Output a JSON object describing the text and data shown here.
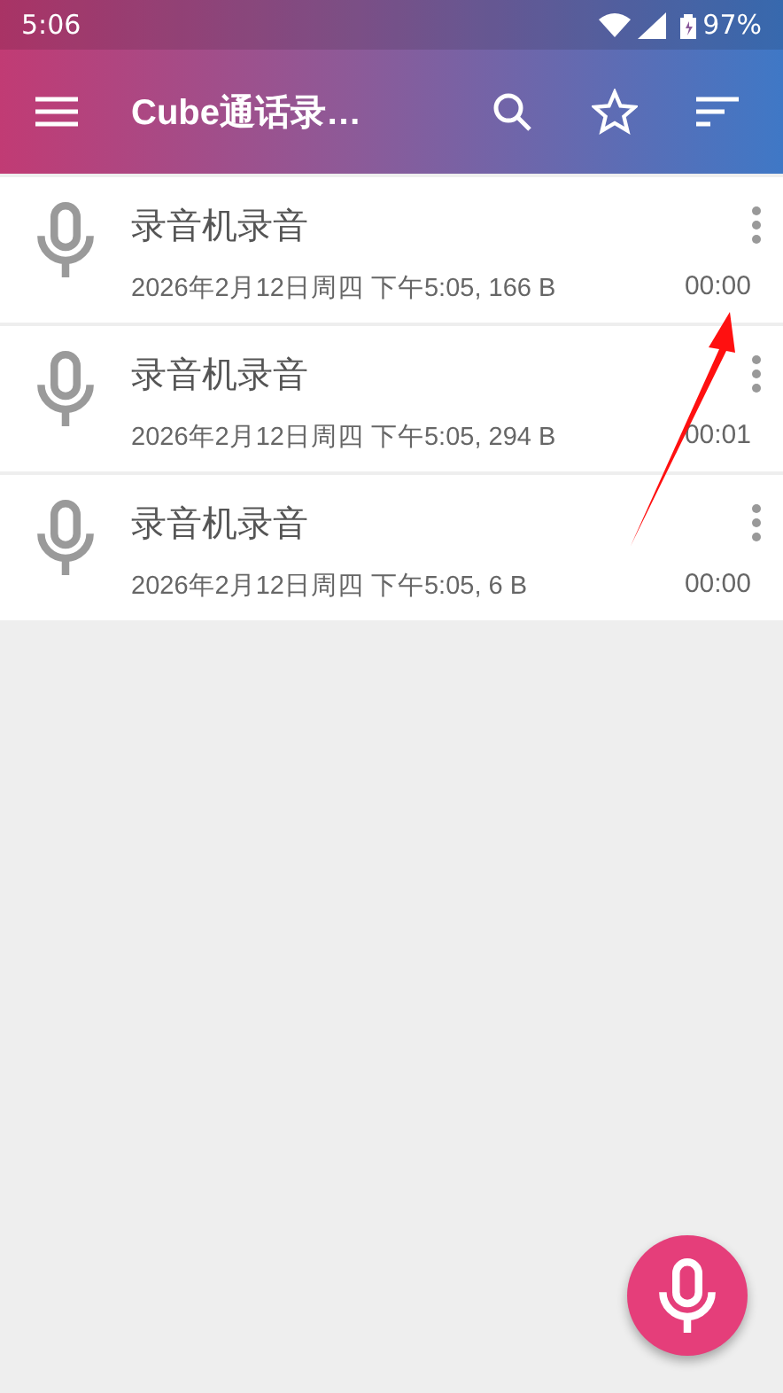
{
  "status_bar": {
    "time": "5:06",
    "battery": "97%"
  },
  "toolbar": {
    "title": "Cube通话录…"
  },
  "recordings": [
    {
      "title": "录音机录音",
      "details": "2026年2月12日周四 下午5:05, 166 B",
      "duration": "00:00"
    },
    {
      "title": "录音机录音",
      "details": "2026年2月12日周四 下午5:05, 294 B",
      "duration": "00:01"
    },
    {
      "title": "录音机录音",
      "details": "2026年2月12日周四 下午5:05, 6 B",
      "duration": "00:00"
    }
  ]
}
